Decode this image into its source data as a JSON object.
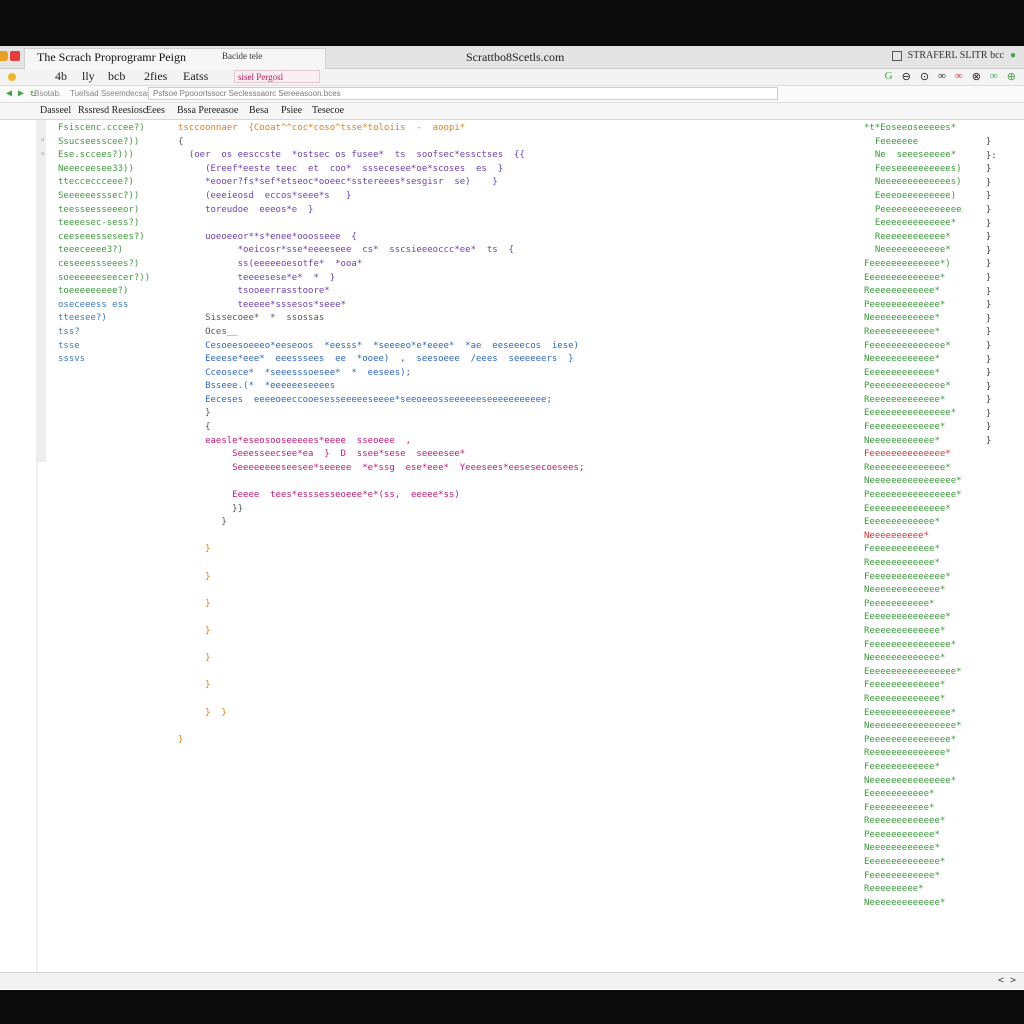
{
  "titlebar": {
    "window_title": "The Scrach Proprogramr Peign",
    "tab_label": "Bacide tele",
    "site_title": "Scrattbo8Scetls.com",
    "right_text": "STRAFERL SLITR bcc"
  },
  "menu": {
    "items": [
      "4b",
      "lly",
      "bcb",
      "2fies",
      "Eatss"
    ],
    "pink_field": "sisel Pergosl",
    "right_icons": [
      "G",
      "⊖",
      "⊙",
      "∞",
      "∞",
      "⊗",
      "∞",
      "⊕"
    ]
  },
  "address": {
    "nav": "◀ ▶ ↻",
    "left_text": "Bsotab.",
    "mid_text": "Tuefsad  Sseemdecsass",
    "value": "Psfsoe Ppooorlssocr  Seclesssaorc  Sereeasoon.bces"
  },
  "toolbar": {
    "items": [
      "Dasseel",
      "Rssresd Reesiosc",
      "Eees",
      "Bssa Pereeasoe",
      "Besa",
      "Psiee",
      "Tesecoe"
    ]
  },
  "code": {
    "left": [
      "Fsiscenc.cccee?)",
      "Ssucseesscee?))",
      "Ese.sccees?)))",
      "Neeeceesee33))",
      "ttecceccceee?)",
      "Seeeeeesssec?))",
      "teesseesseeeor)",
      "teeeesec-sess?)",
      "ceeseeessesees?)",
      "teeeceeee3?)",
      "ceseeessseees?)",
      "soeeeeeeseecer?))",
      "toeeeeeeeee?)",
      "oseceeess ess",
      "tteesee?)",
      "tss?",
      "tsse",
      "sssvs",
      ""
    ],
    "mid": [
      "tsccoonnaer  {Cooat^^coc*coso^tsse*toloiis  -  aoopi*",
      "{",
      "  (oer  os eesccste  *ostsec os fusee*  ts  soofsec*essctses  {{",
      "     (Ereef*eeste teec  et  coo*  sssecesee*oe*scoses  es  }",
      "     *eooer?fs*sef*etseoc*ooeec*sstereees*sesgisr  se)    }",
      "     (eeeieosd  eccos*seee*s   }",
      "     toreudoe  eeeos*e  }",
      "",
      "     uoeoeeor**s*enee*ooosseee  {",
      "           *oeicosr*sse*eeeeseee  cs*  sscsieeeoccc*ee*  ts  {",
      "           ss(eeeeeoesotfe*  *ooa*",
      "           teeeesese*e*  *  }",
      "           tsooeerrasstoore*",
      "           teeeee*sssesos*seee*",
      "     Sissecoee*  *  ssossas",
      "     Oces__",
      "     Cesoeesoeeeo*eeseoos  *eesss*  *seeeeo*e*eeee*  *ae  eeseeecos  iese)",
      "     Eeeese*eee*  eeesssees  ee  *ooee)  ,  seesoeee  /eees  seeeeeers  }",
      "     Cceosece*  *seeesssoesee*  *  eesees);",
      "     Bsseee.(*  *eeeeeeseeees",
      "     Eeceses  eeeeoeeccooesesseeeeeseeee*seeoeeosseeeeeeseeeeeeeeeee;",
      "     }",
      "     {",
      "     eaesle*eseosooseeeees*eeee  sseoeee  ,",
      "          Seeesseecsee*ea  }  D  ssee*sese  seeeesee*",
      "          Seeeeeeeeseesee*seeeee  *e*ssg  ese*eee*  Yeeesees*eesesecoesees;",
      "",
      "          Eeeee  tees*esssesseoeee*e*(ss,  eeeee*ss)",
      "          }}",
      "        }",
      "",
      "     }",
      "",
      "     }",
      "",
      "     }",
      "",
      "     }",
      "",
      "     }",
      "",
      "     }",
      "",
      "     }  }",
      "",
      "}"
    ],
    "right": [
      "*t*Eoseeoseeeees*",
      "  Feeeeeee",
      "  Ne  seeeseeeee*",
      "  Feeseeeeeeeeees)",
      "  Neeeeeeeeeeeees)",
      "  Eeeeoeeeeeeeee)",
      "  Peeeeeeeeeeeeeee",
      "  Eeeeeeeeeeeeee*",
      "  Reeeeeeeeeeee*",
      "  Neeeeeeeeeeee*",
      "Feeeeeeeeeeeee*)",
      "Eeeeeeeeeeeeee*",
      "Reeeeeeeeeeee*",
      "Peeeeeeeeeeeee*",
      "Neeeeeeeeeeee*",
      "Reeeeeeeeeeee*",
      "Feeeeeeeeeeeeee*",
      "Neeeeeeeeeeee*",
      "Eeeeeeeeeeeee*",
      "Peeeeeeeeeeeeee*",
      "Reeeeeeeeeeeee*",
      "Eeeeeeeeeeeeeeee*",
      "Feeeeeeeeeeeee*",
      "Neeeeeeeeeeee*",
      "Feeeeeeeeeeeeee*",
      "Reeeeeeeeeeeeee*",
      "Neeeeeeeeeeeeeeee*",
      "Peeeeeeeeeeeeeeee*",
      "Eeeeeeeeeeeeeee*",
      "Eeeeeeeeeeeee*",
      "Neeeeeeeeee*",
      "Feeeeeeeeeeee*",
      "Reeeeeeeeeeee*",
      "Feeeeeeeeeeeeee*",
      "Neeeeeeeeeeeee*",
      "Peeeeeeeeeee*",
      "Eeeeeeeeeeeeeee*",
      "Reeeeeeeeeeeee*",
      "Feeeeeeeeeeeeeee*",
      "Neeeeeeeeeeeee*",
      "Eeeeeeeeeeeeeeeee*",
      "Feeeeeeeeeeeee*",
      "Reeeeeeeeeeeee*",
      "Eeeeeeeeeeeeeeee*",
      "Neeeeeeeeeeeeeeee*",
      "Peeeeeeeeeeeeeee*",
      "Reeeeeeeeeeeeee*",
      "Feeeeeeeeeeee*",
      "Neeeeeeeeeeeeeee*",
      "Eeeeeeeeeeee*",
      "Feeeeeeeeeee*",
      "Reeeeeeeeeeeee*",
      "Peeeeeeeeeeee*",
      "Neeeeeeeeeeee*",
      "Eeeeeeeeeeeeee*",
      "Feeeeeeeeeeee*",
      "Reeeeeeeee*",
      "Neeeeeeeeeeeee*"
    ],
    "far": [
      "  }",
      "  }:",
      "  }",
      "  }",
      "  }",
      "  }",
      "  }",
      "  }",
      "  }",
      "  }",
      "  }",
      "  }",
      "  }",
      "  }",
      "  }",
      "  }",
      "  }",
      "  }",
      "  }",
      "  }",
      "  }",
      "  }",
      "  }"
    ]
  },
  "statusbar": {
    "arrows": "< >"
  }
}
